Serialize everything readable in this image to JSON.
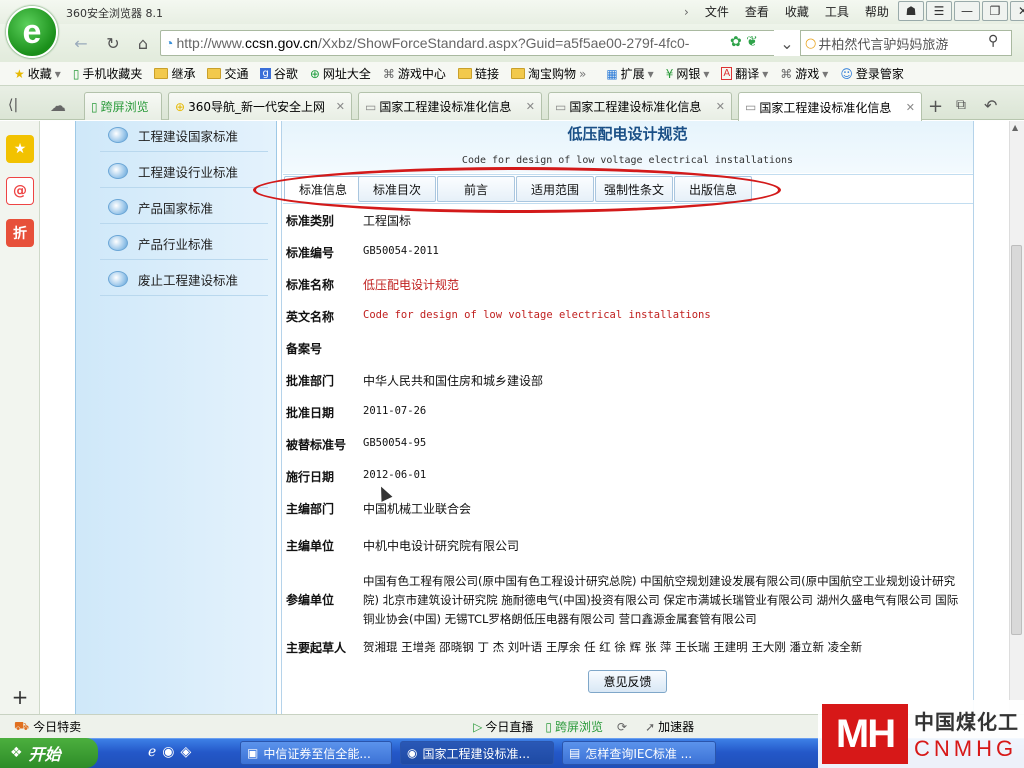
{
  "browser": {
    "app_title": "360安全浏览器 8.1",
    "menus": [
      "文件",
      "查看",
      "收藏",
      "工具",
      "帮助"
    ],
    "url": {
      "scheme": "http://www.",
      "host": "ccsn.gov.cn",
      "path": "/Xxbz/ShowForceStandard.aspx?Guid=a5f5ae00-279f-4fc0-"
    },
    "search_text": "井柏然代言驴妈妈旅游",
    "bookmarks": [
      "收藏",
      "手机收藏夹",
      "继承",
      "交通",
      "谷歌",
      "网址大全",
      "游戏中心",
      "链接",
      "淘宝购物",
      "扩展",
      "网银",
      "翻译",
      "游戏",
      "登录管家"
    ],
    "tabs": [
      {
        "label": "跨屏浏览"
      },
      {
        "label": "360导航_新一代安全上网"
      },
      {
        "label": "国家工程建设标准化信息"
      },
      {
        "label": "国家工程建设标准化信息"
      },
      {
        "label": "国家工程建设标准化信息"
      }
    ]
  },
  "sidebar": {
    "items": [
      "工程建设国家标准",
      "工程建设行业标准",
      "产品国家标准",
      "产品行业标准",
      "废止工程建设标准"
    ]
  },
  "standard": {
    "title_cn": "低压配电设计规范",
    "title_en": "Code for design of low voltage electrical installations",
    "tabs": [
      "标准信息",
      "标准目次",
      "前言",
      "适用范围",
      "强制性条文",
      "出版信息"
    ],
    "fields": [
      {
        "label": "标准类别",
        "value": "工程国标"
      },
      {
        "label": "标准编号",
        "value": "GB50054-2011"
      },
      {
        "label": "标准名称",
        "value": "低压配电设计规范"
      },
      {
        "label": "英文名称",
        "value": "Code for design of low voltage electrical installations"
      },
      {
        "label": "备案号",
        "value": ""
      },
      {
        "label": "批准部门",
        "value": "中华人民共和国住房和城乡建设部"
      },
      {
        "label": "批准日期",
        "value": "2011-07-26"
      },
      {
        "label": "被替标准号",
        "value": "GB50054-95"
      },
      {
        "label": "施行日期",
        "value": "2012-06-01"
      },
      {
        "label": "主编部门",
        "value": "中国机械工业联合会"
      },
      {
        "label": "主编单位",
        "value": "中机中电设计研究院有限公司"
      },
      {
        "label": "参编单位",
        "value": "中国有色工程有限公司(原中国有色工程设计研究总院) 中国航空规划建设发展有限公司(原中国航空工业规划设计研究院) 北京市建筑设计研究院 施耐德电气(中国)投资有限公司 保定市满城长瑞管业有限公司 湖州久盛电气有限公司 国际铜业协会(中国) 无锡TCL罗格朗低压电器有限公司 营口鑫源金属套管有限公司"
      },
      {
        "label": "主要起草人",
        "value": "贺湘琨 王增尧 邵晓钢 丁 杰 刘叶语 王厚余 任 红 徐 辉 张 萍 王长瑞 王建明 王大刚 潘立新 凌全新"
      }
    ],
    "feedback_label": "意见反馈"
  },
  "statusbar": {
    "left": "今日特卖",
    "items": [
      "今日直播",
      "跨屏浏览",
      "加速器"
    ]
  },
  "taskbar": {
    "start": "开始",
    "tasks": [
      "中信证券至信全能...",
      "国家工程建设标准...",
      "怎样查询IEC标准 ..."
    ]
  },
  "watermark": {
    "logo": "MH",
    "cn": "中国煤化工",
    "en": "CNMHG"
  },
  "colors": {
    "accent_red": "#d31a1a",
    "title_blue": "#1a4f86",
    "sidebar_blue": "#cfe8f9"
  }
}
